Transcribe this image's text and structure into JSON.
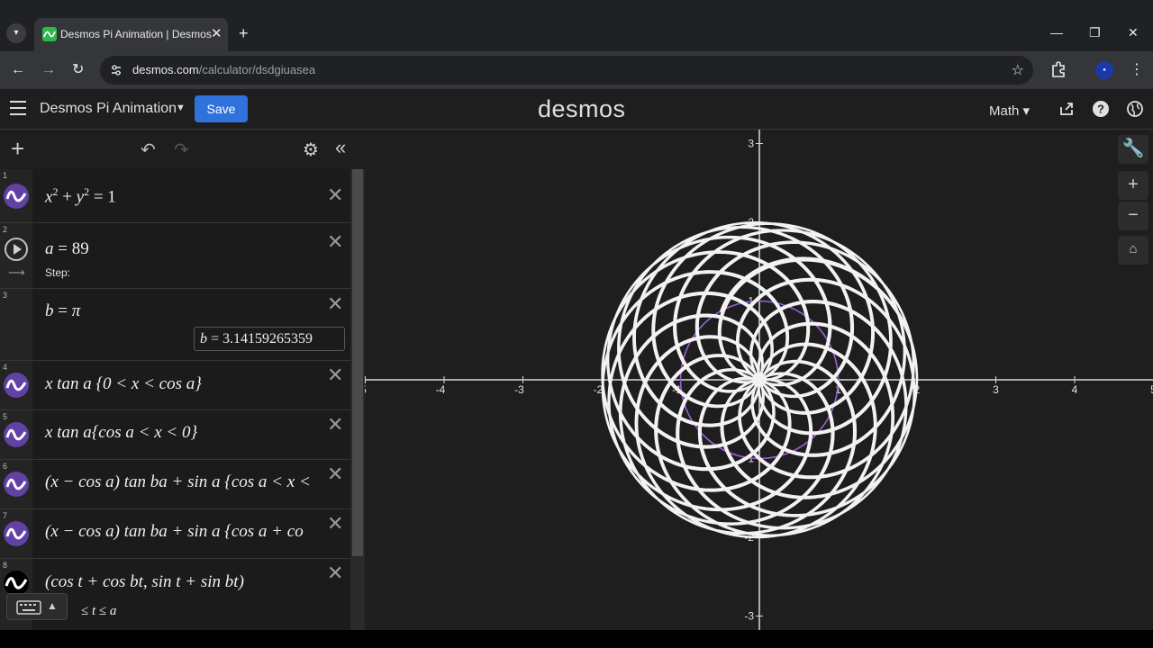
{
  "browser": {
    "tab_title": "Desmos Pi Animation | Desmos",
    "url_host": "desmos.com",
    "url_path": "/calculator/dsdgiuasea"
  },
  "header": {
    "graph_title": "Desmos Pi Animation",
    "save_label": "Save",
    "logo": "desmos",
    "math_menu": "Math"
  },
  "expressions": [
    {
      "num": "1",
      "latex_display": "x² + y² = 1"
    },
    {
      "num": "2",
      "name": "a",
      "value": "89",
      "step_label": "Step:"
    },
    {
      "num": "3",
      "name": "b",
      "value": "π",
      "evaluation": "3.14159265359"
    },
    {
      "num": "4",
      "text": "x tan a {0 < x < cos a}"
    },
    {
      "num": "5",
      "text": "x tan a{cos a < x < 0}"
    },
    {
      "num": "6",
      "text": "(x − cos a) tan ba + sin a {cos a < x <"
    },
    {
      "num": "7",
      "text": "(x − cos a) tan ba + sin a {cos a + co"
    },
    {
      "num": "8",
      "text": "(cos t + cos bt, sin t + sin bt)",
      "domain": "≤ t ≤ a"
    }
  ],
  "graph": {
    "x_ticks": [
      "-5",
      "-4",
      "-3",
      "-2",
      "-1",
      "1",
      "2",
      "3",
      "4",
      "5"
    ],
    "y_ticks": [
      "3",
      "2",
      "1",
      "-1",
      "-2",
      "-3"
    ],
    "curve_color": "#f2f2f2",
    "circle_color": "#9b5fd6"
  },
  "colors": {
    "accent": "#2f72dc",
    "purple": "#6042a6"
  }
}
